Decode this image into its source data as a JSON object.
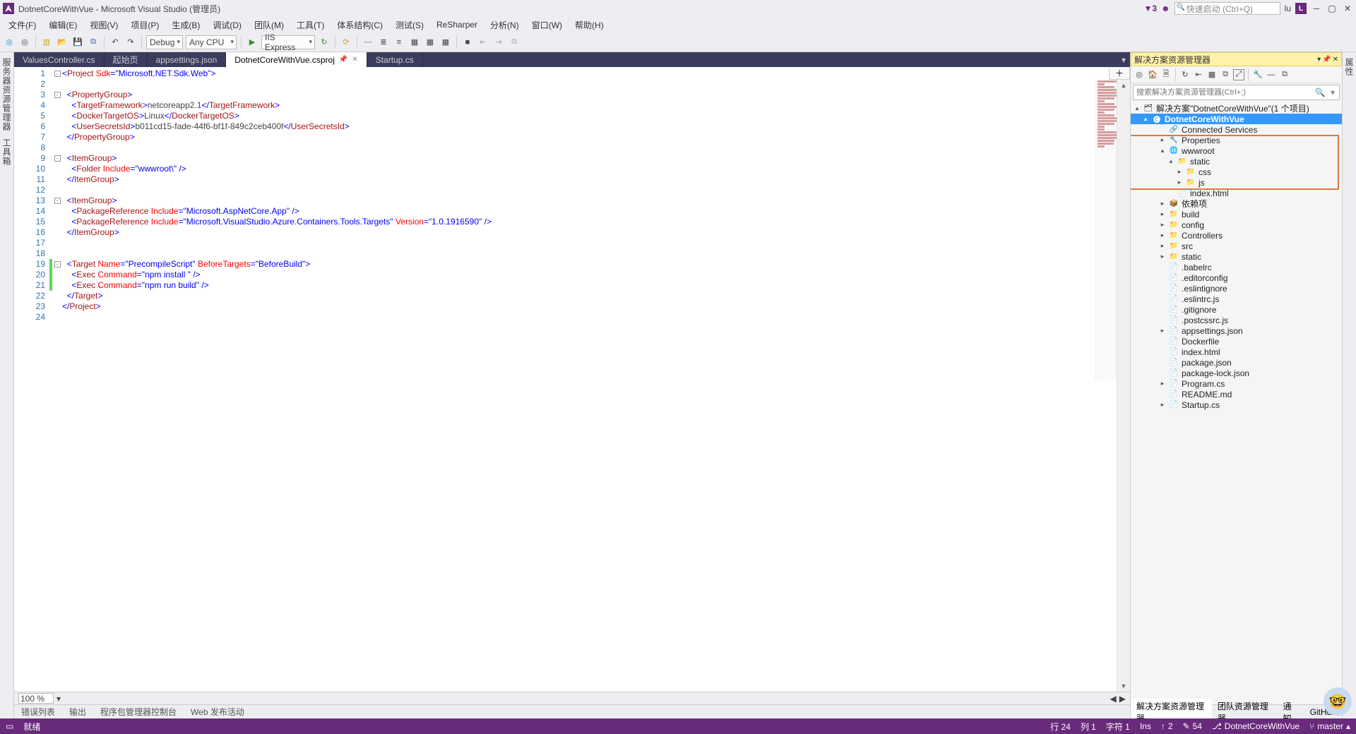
{
  "title": "DotnetCoreWithVue - Microsoft Visual Studio  (管理员)",
  "quick_launch_placeholder": "快速启动 (Ctrl+Q)",
  "notif_count": "3",
  "user_short": "lu",
  "user_initial": "L",
  "menu": [
    "文件(F)",
    "编辑(E)",
    "视图(V)",
    "项目(P)",
    "生成(B)",
    "调试(D)",
    "团队(M)",
    "工具(T)",
    "体系结构(C)",
    "测试(S)",
    "ReSharper",
    "分析(N)",
    "窗口(W)",
    "帮助(H)"
  ],
  "toolbar": {
    "config": "Debug",
    "platform": "Any CPU",
    "run_target": "IIS Express"
  },
  "tabs": [
    {
      "label": "ValuesController.cs",
      "active": false
    },
    {
      "label": "起始页",
      "active": false
    },
    {
      "label": "appsettings.json",
      "active": false
    },
    {
      "label": "DotnetCoreWithVue.csproj",
      "active": true
    },
    {
      "label": "Startup.cs",
      "active": false
    }
  ],
  "code_lines": [
    {
      "n": 1,
      "mark": "",
      "html": "<span class='tok-delim'>&lt;</span><span class='tok-tag'>Project</span> <span class='tok-attr'>Sdk</span><span class='tok-delim'>=</span><span class='tok-str'>\"Microsoft.NET.Sdk.Web\"</span><span class='tok-delim'>&gt;</span>"
    },
    {
      "n": 2,
      "mark": "",
      "html": ""
    },
    {
      "n": 3,
      "mark": "",
      "html": "  <span class='tok-delim'>&lt;</span><span class='tok-tag'>PropertyGroup</span><span class='tok-delim'>&gt;</span>"
    },
    {
      "n": 4,
      "mark": "",
      "html": "    <span class='tok-delim'>&lt;</span><span class='tok-tag'>TargetFramework</span><span class='tok-delim'>&gt;</span><span class='tok-txt'>netcoreapp2.1</span><span class='tok-delim'>&lt;/</span><span class='tok-tag'>TargetFramework</span><span class='tok-delim'>&gt;</span>"
    },
    {
      "n": 5,
      "mark": "",
      "html": "    <span class='tok-delim'>&lt;</span><span class='tok-tag'>DockerTargetOS</span><span class='tok-delim'>&gt;</span><span class='tok-txt'>Linux</span><span class='tok-delim'>&lt;/</span><span class='tok-tag'>DockerTargetOS</span><span class='tok-delim'>&gt;</span>"
    },
    {
      "n": 6,
      "mark": "",
      "html": "    <span class='tok-delim'>&lt;</span><span class='tok-tag'>UserSecretsId</span><span class='tok-delim'>&gt;</span><span class='tok-txt'>b011cd15-fade-44f6-bf1f-849c2ceb400f</span><span class='tok-delim'>&lt;/</span><span class='tok-tag'>UserSecretsId</span><span class='tok-delim'>&gt;</span>"
    },
    {
      "n": 7,
      "mark": "",
      "html": "  <span class='tok-delim'>&lt;/</span><span class='tok-tag'>PropertyGroup</span><span class='tok-delim'>&gt;</span>"
    },
    {
      "n": 8,
      "mark": "",
      "html": ""
    },
    {
      "n": 9,
      "mark": "",
      "html": "  <span class='tok-delim'>&lt;</span><span class='tok-tag'>ItemGroup</span><span class='tok-delim'>&gt;</span>"
    },
    {
      "n": 10,
      "mark": "",
      "html": "    <span class='tok-delim'>&lt;</span><span class='tok-tag'>Folder</span> <span class='tok-attr'>Include</span><span class='tok-delim'>=</span><span class='tok-str'>\"wwwroot\\\"</span> <span class='tok-delim'>/&gt;</span>"
    },
    {
      "n": 11,
      "mark": "",
      "html": "  <span class='tok-delim'>&lt;/</span><span class='tok-tag'>ItemGroup</span><span class='tok-delim'>&gt;</span>"
    },
    {
      "n": 12,
      "mark": "",
      "html": ""
    },
    {
      "n": 13,
      "mark": "",
      "html": "  <span class='tok-delim'>&lt;</span><span class='tok-tag'>ItemGroup</span><span class='tok-delim'>&gt;</span>"
    },
    {
      "n": 14,
      "mark": "",
      "html": "    <span class='tok-delim'>&lt;</span><span class='tok-tag'>PackageReference</span> <span class='tok-attr'>Include</span><span class='tok-delim'>=</span><span class='tok-str'>\"Microsoft.AspNetCore.App\"</span> <span class='tok-delim'>/&gt;</span>"
    },
    {
      "n": 15,
      "mark": "",
      "html": "    <span class='tok-delim'>&lt;</span><span class='tok-tag'>PackageReference</span> <span class='tok-attr'>Include</span><span class='tok-delim'>=</span><span class='tok-str'>\"Microsoft.VisualStudio.Azure.Containers.Tools.Targets\"</span> <span class='tok-attr'>Version</span><span class='tok-delim'>=</span><span class='tok-str'>\"1.0.1916590\"</span> <span class='tok-delim'>/&gt;</span>"
    },
    {
      "n": 16,
      "mark": "",
      "html": "  <span class='tok-delim'>&lt;/</span><span class='tok-tag'>ItemGroup</span><span class='tok-delim'>&gt;</span>"
    },
    {
      "n": 17,
      "mark": "",
      "html": ""
    },
    {
      "n": 18,
      "mark": "",
      "html": ""
    },
    {
      "n": 19,
      "mark": "green",
      "html": "  <span class='tok-delim'>&lt;</span><span class='tok-tag'>Target</span> <span class='tok-attr'>Name</span><span class='tok-delim'>=</span><span class='tok-str'>\"PrecompileScript\"</span> <span class='tok-attr'>BeforeTargets</span><span class='tok-delim'>=</span><span class='tok-str'>\"BeforeBuild\"</span><span class='tok-delim'>&gt;</span>"
    },
    {
      "n": 20,
      "mark": "green",
      "html": "    <span class='tok-delim'>&lt;</span><span class='tok-tag'>Exec</span> <span class='tok-attr'>Command</span><span class='tok-delim'>=</span><span class='tok-str'>\"npm install \"</span> <span class='tok-delim'>/&gt;</span>"
    },
    {
      "n": 21,
      "mark": "green",
      "html": "    <span class='tok-delim'>&lt;</span><span class='tok-tag'>Exec</span> <span class='tok-attr'>Command</span><span class='tok-delim'>=</span><span class='tok-str'>\"npm run build\"</span> <span class='tok-delim'>/&gt;</span>"
    },
    {
      "n": 22,
      "mark": "",
      "html": "  <span class='tok-delim'>&lt;/</span><span class='tok-tag'>Target</span><span class='tok-delim'>&gt;</span>"
    },
    {
      "n": 23,
      "mark": "",
      "html": "<span class='tok-delim'>&lt;/</span><span class='tok-tag'>Project</span><span class='tok-delim'>&gt;</span>"
    },
    {
      "n": 24,
      "mark": "",
      "html": ""
    }
  ],
  "zoom": "100 %",
  "bottom_tabs": [
    "错误列表",
    "输出",
    "程序包管理器控制台",
    "Web 发布活动"
  ],
  "sx": {
    "title": "解决方案资源管理器",
    "search_placeholder": "搜索解决方案资源管理器(Ctrl+;)",
    "solution": "解决方案\"DotnetCoreWithVue\"(1 个项目)",
    "project": "DotnetCoreWithVue",
    "nodes": [
      {
        "depth": 2,
        "tw": "",
        "icon": "🔗",
        "label": "Connected Services"
      },
      {
        "depth": 2,
        "tw": "▸",
        "icon": "🔧",
        "label": "Properties"
      },
      {
        "depth": 2,
        "tw": "▴",
        "icon": "🌐",
        "label": "wwwroot"
      },
      {
        "depth": 3,
        "tw": "▴",
        "icon": "📁",
        "label": "static"
      },
      {
        "depth": 4,
        "tw": "▸",
        "icon": "📁",
        "label": "css"
      },
      {
        "depth": 4,
        "tw": "▸",
        "icon": "📁",
        "label": "js"
      },
      {
        "depth": 3,
        "tw": "",
        "icon": "📄",
        "label": "index.html"
      },
      {
        "depth": 2,
        "tw": "▸",
        "icon": "📦",
        "label": "依赖项"
      },
      {
        "depth": 2,
        "tw": "▸",
        "icon": "📁",
        "label": "build"
      },
      {
        "depth": 2,
        "tw": "▸",
        "icon": "📁",
        "label": "config"
      },
      {
        "depth": 2,
        "tw": "▸",
        "icon": "📁",
        "label": "Controllers"
      },
      {
        "depth": 2,
        "tw": "▸",
        "icon": "📁",
        "label": "src"
      },
      {
        "depth": 2,
        "tw": "▸",
        "icon": "📁",
        "label": "static"
      },
      {
        "depth": 2,
        "tw": "",
        "icon": "📄",
        "label": ".babelrc"
      },
      {
        "depth": 2,
        "tw": "",
        "icon": "📄",
        "label": ".editorconfig"
      },
      {
        "depth": 2,
        "tw": "",
        "icon": "📄",
        "label": ".eslintignore"
      },
      {
        "depth": 2,
        "tw": "",
        "icon": "📄",
        "label": ".eslintrc.js"
      },
      {
        "depth": 2,
        "tw": "",
        "icon": "📄",
        "label": ".gitignore"
      },
      {
        "depth": 2,
        "tw": "",
        "icon": "📄",
        "label": ".postcssrc.js"
      },
      {
        "depth": 2,
        "tw": "▸",
        "icon": "📄",
        "label": "appsettings.json"
      },
      {
        "depth": 2,
        "tw": "",
        "icon": "📄",
        "label": "Dockerfile"
      },
      {
        "depth": 2,
        "tw": "",
        "icon": "📄",
        "label": "index.html"
      },
      {
        "depth": 2,
        "tw": "",
        "icon": "📄",
        "label": "package.json"
      },
      {
        "depth": 2,
        "tw": "",
        "icon": "📄",
        "label": "package-lock.json"
      },
      {
        "depth": 2,
        "tw": "▸",
        "icon": "📄",
        "label": "Program.cs"
      },
      {
        "depth": 2,
        "tw": "",
        "icon": "📄",
        "label": "README.md"
      },
      {
        "depth": 2,
        "tw": "▸",
        "icon": "📄",
        "label": "Startup.cs"
      }
    ],
    "bottom_tabs": [
      "解决方案资源管理器",
      "团队资源管理器",
      "通知",
      "GitHub"
    ]
  },
  "status": {
    "ready": "就绪",
    "line": "行 24",
    "col": "列 1",
    "char": "字符 1",
    "ins": "Ins",
    "changes_up": "2",
    "changes_pencil": "54",
    "repo": "DotnetCoreWithVue",
    "branch": "master"
  },
  "left_rail": [
    "服务器资源管理器",
    "工具箱"
  ],
  "right_rail": "属性"
}
